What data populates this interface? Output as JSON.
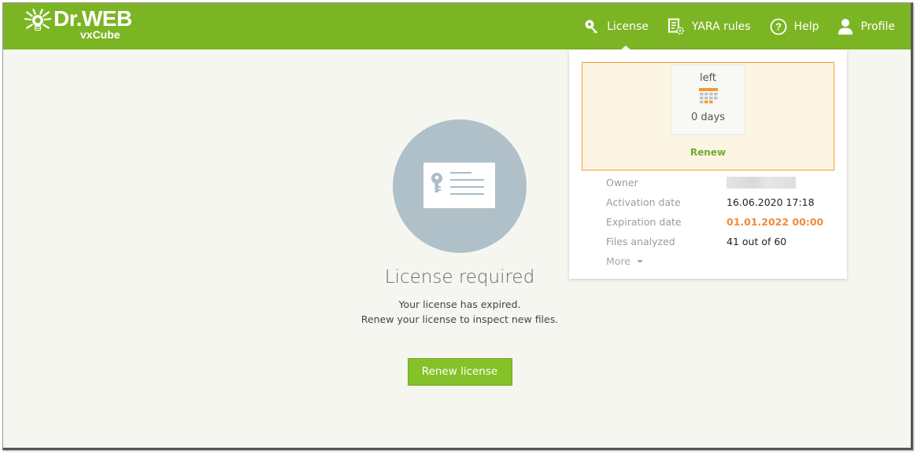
{
  "brand": {
    "title": "Dr.WEB",
    "subtitle": "vxCube",
    "color": "#7cb524"
  },
  "nav": {
    "items": [
      {
        "label": "License",
        "icon": "key-search-icon",
        "active": true
      },
      {
        "label": "YARA rules",
        "icon": "document-gear-icon"
      },
      {
        "label": "Help",
        "icon": "question-circle-icon"
      },
      {
        "label": "Profile",
        "icon": "user-icon"
      }
    ]
  },
  "license_popup": {
    "days_label": "left",
    "days_value": "0 days",
    "calendar_icon": "calendar-icon",
    "renew_label": "Renew",
    "rows": [
      {
        "key": "Owner",
        "value": ""
      },
      {
        "key": "Activation date",
        "value": "16.06.2020 17:18"
      },
      {
        "key": "Expiration date",
        "value": "01.01.2022 00:00"
      },
      {
        "key": "Files analyzed",
        "value": "41 out of 60"
      }
    ],
    "more_label": "More",
    "colors": {
      "warning": "#f28a3a",
      "renew": "#74ad2a"
    }
  },
  "main": {
    "title": "License required",
    "line1": "Your license has expired.",
    "line2": "Renew your license to inspect new files.",
    "button_label": "Renew license"
  }
}
